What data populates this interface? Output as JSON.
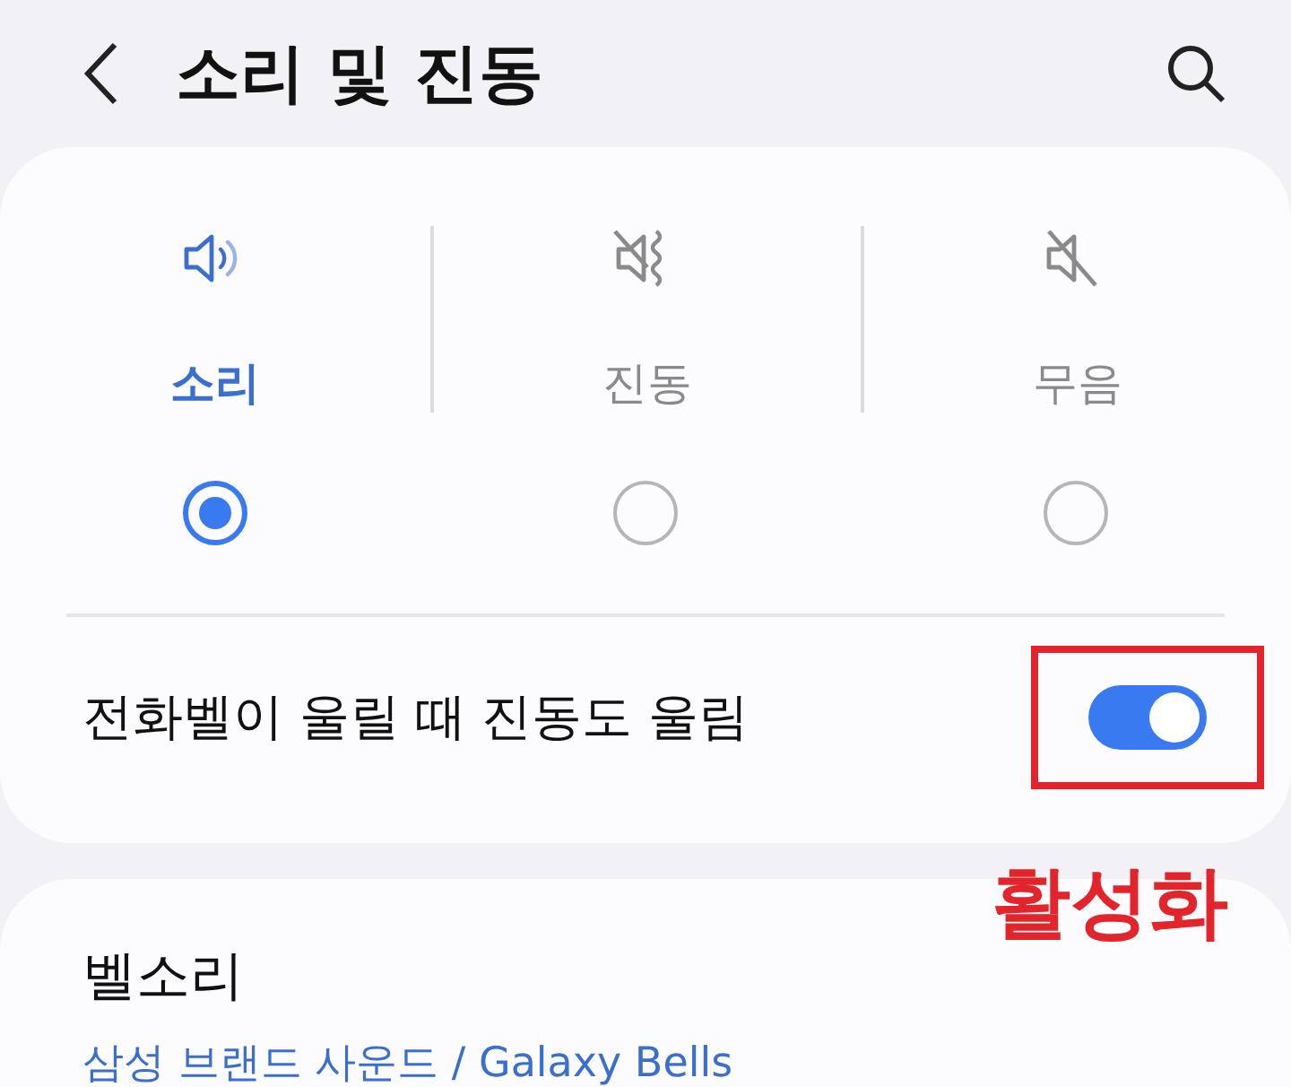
{
  "header": {
    "title": "소리 및 진동"
  },
  "modes": [
    {
      "kind": "sound",
      "label": "소리",
      "selected": true
    },
    {
      "kind": "vibrate",
      "label": "진동",
      "selected": false
    },
    {
      "kind": "mute",
      "label": "무음",
      "selected": false
    }
  ],
  "vibrate_row": {
    "label": "전화벨이 울릴 때 진동도 울림",
    "on": true,
    "highlighted": true
  },
  "annotation": {
    "label": "활성화"
  },
  "ringtone": {
    "title": "벨소리",
    "value": "삼성 브랜드 사운드 / Galaxy Bells"
  }
}
